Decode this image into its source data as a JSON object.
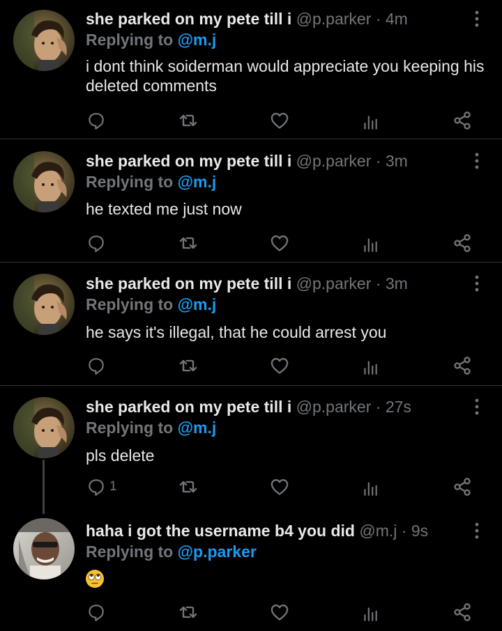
{
  "tweets": [
    {
      "name": "she parked on my pete till i",
      "handle": "@p.parker",
      "time": "4m",
      "reply_prefix": "Replying to",
      "reply_to": "@m.j",
      "text": "i dont think soiderman would appreciate you keeping his deleted comments",
      "avatar": "peter-parker-avatar",
      "reply_count": ""
    },
    {
      "name": "she parked on my pete till i",
      "handle": "@p.parker",
      "time": "3m",
      "reply_prefix": "Replying to",
      "reply_to": "@m.j",
      "text": "he texted me just now",
      "avatar": "peter-parker-avatar",
      "reply_count": ""
    },
    {
      "name": "she parked on my pete till i",
      "handle": "@p.parker",
      "time": "3m",
      "reply_prefix": "Replying to",
      "reply_to": "@m.j",
      "text": "he says it's illegal, that he could arrest you",
      "avatar": "peter-parker-avatar",
      "reply_count": ""
    },
    {
      "name": "she parked on my pete till i",
      "handle": "@p.parker",
      "time": "27s",
      "reply_prefix": "Replying to",
      "reply_to": "@m.j",
      "text": "pls delete",
      "avatar": "peter-parker-avatar",
      "reply_count": "1"
    },
    {
      "name": "haha i got the username b4 you did",
      "handle": "@m.j",
      "time": "9s",
      "reply_prefix": "Replying to",
      "reply_to": "@p.parker",
      "text": "",
      "emoji": "eye-roll-emoji",
      "avatar": "mj-avatar",
      "reply_count": ""
    }
  ],
  "separator": "·",
  "icons": {
    "reply": "reply-icon",
    "retweet": "retweet-icon",
    "like": "heart-icon",
    "views": "views-chart-icon",
    "share": "share-icon",
    "more": "more-vertical-icon"
  },
  "colors": {
    "background": "#000000",
    "text": "#e7e9ea",
    "muted": "#71767b",
    "link": "#1d9bf0",
    "divider": "#2f3336"
  }
}
